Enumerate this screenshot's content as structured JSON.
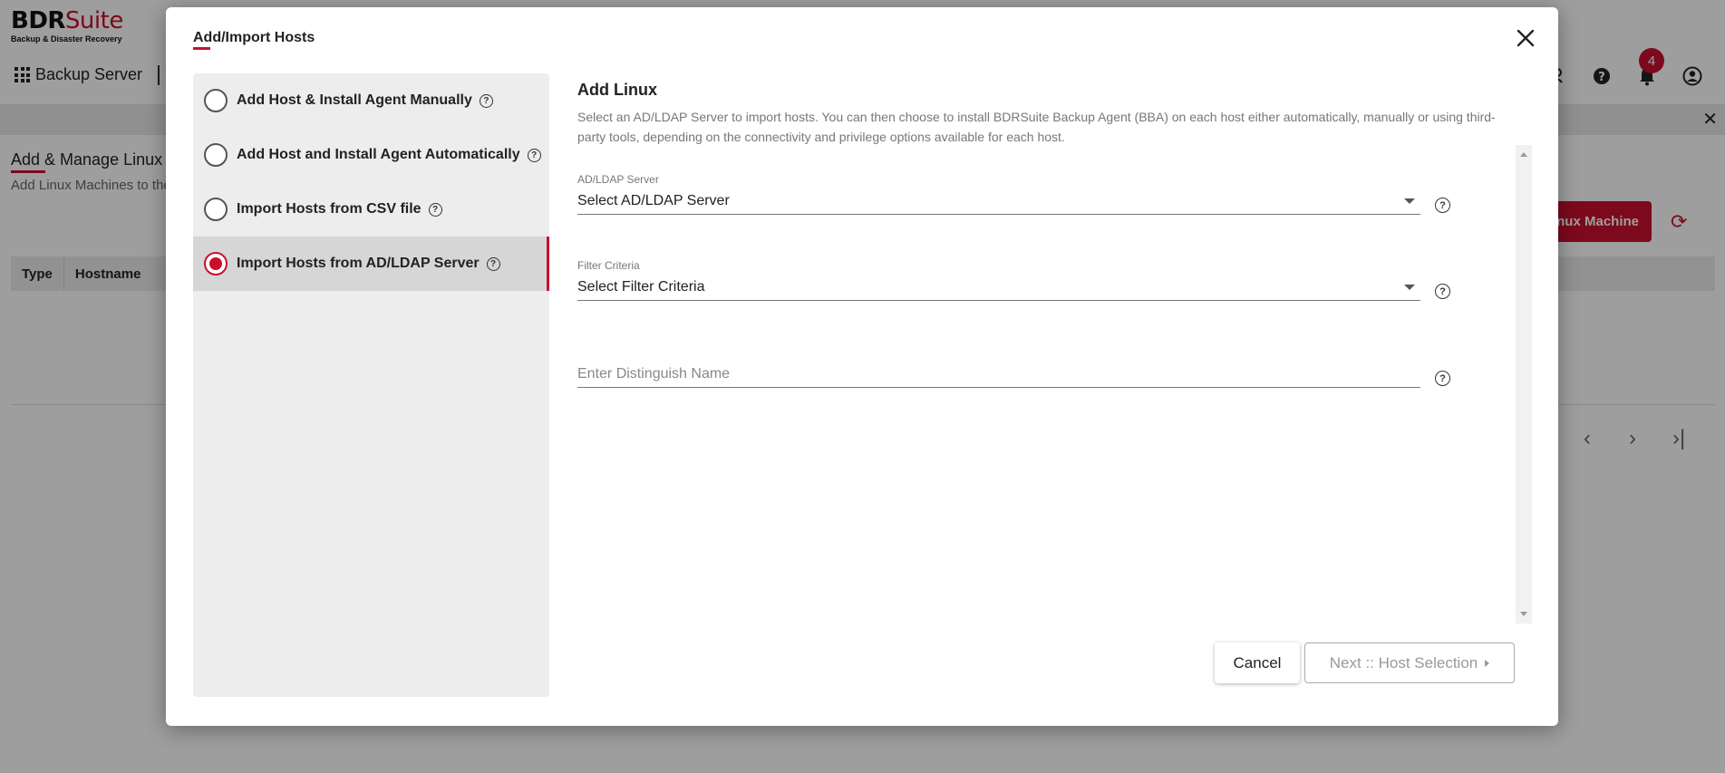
{
  "background": {
    "logo": {
      "part1": "BDR",
      "part2": "Suite",
      "tagline": "Backup & Disaster Recovery"
    },
    "app_switcher_label": "Backup Server",
    "notification_count": "4",
    "page_title": "Add & Manage Linux M",
    "page_subtitle": "Add Linux Machines to the",
    "add_button_label": "nux Machine",
    "table_headers": [
      "Type",
      "Hostname"
    ]
  },
  "modal": {
    "title": "Add/Import Hosts",
    "options": [
      {
        "label": "Add Host & Install Agent Manually",
        "selected": false
      },
      {
        "label": "Add Host and Install Agent Automatically",
        "selected": false
      },
      {
        "label": "Import Hosts from CSV file",
        "selected": false
      },
      {
        "label": "Import Hosts from AD/LDAP Server",
        "selected": true
      }
    ],
    "section_title": "Add Linux",
    "section_description": "Select an AD/LDAP Server to import hosts. You can then choose to install BDRSuite Backup Agent (BBA) on each host either automatically, manually or using third-party tools, depending on the connectivity and privilege options available for each host.",
    "ldap_server": {
      "label": "AD/LDAP Server",
      "value": "Select AD/LDAP Server"
    },
    "filter_criteria": {
      "label": "Filter Criteria",
      "value": "Select Filter Criteria"
    },
    "distinguish_name": {
      "placeholder": "Enter Distinguish Name"
    },
    "cancel_label": "Cancel",
    "next_label": "Next :: Host Selection"
  },
  "colors": {
    "accent": "#c8102e"
  },
  "icons": [
    "apps-grid-icon",
    "help-circle-icon",
    "bell-icon",
    "user-circle-icon",
    "refresh-icon",
    "close-icon",
    "chevron-left-icon",
    "chevron-right-icon",
    "last-page-icon",
    "dropdown-caret-icon"
  ]
}
